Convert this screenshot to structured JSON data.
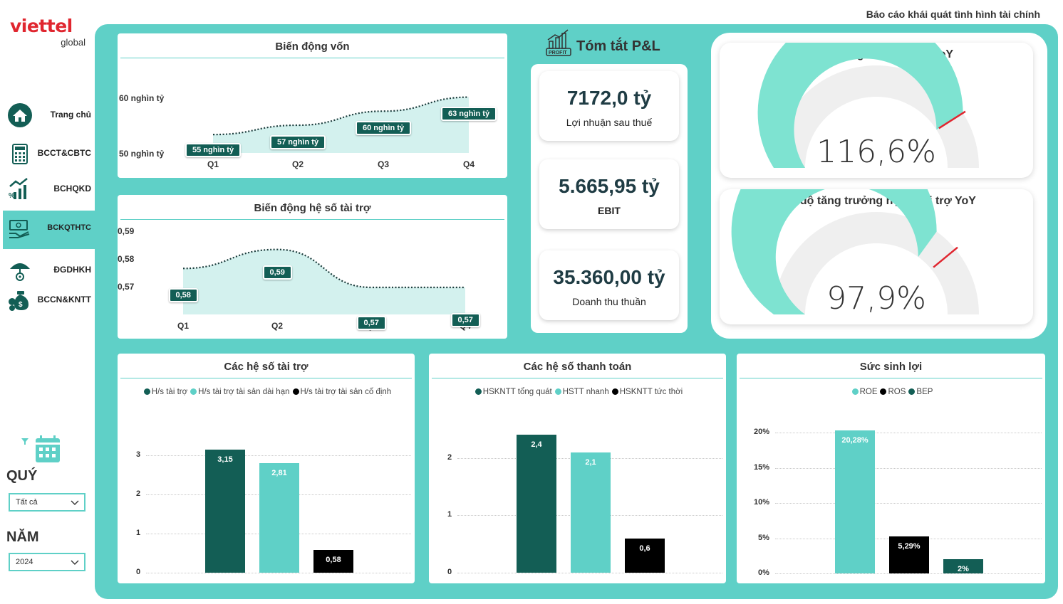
{
  "brand": {
    "name": "viettel",
    "sub": "global"
  },
  "report_title": "Báo cáo khái quát tình hình tài chính",
  "sidebar": {
    "items": [
      {
        "label": "Trang chủ",
        "icon": "home-icon"
      },
      {
        "label": "BCCT&CBTC",
        "icon": "calculator-icon"
      },
      {
        "label": "BCHQKD",
        "icon": "growth-chart-icon"
      },
      {
        "label": "BCKQTHTC",
        "icon": "cash-hand-icon",
        "active": true
      },
      {
        "label": "ĐGDHKH",
        "icon": "umbrella-icon"
      },
      {
        "label": "BCCN&KNTT",
        "icon": "money-bag-icon"
      }
    ]
  },
  "filters": {
    "quarter": {
      "label": "QUÝ",
      "value": "Tất cả"
    },
    "year": {
      "label": "NĂM",
      "value": "2024"
    }
  },
  "capital_chart": {
    "chart_data": {
      "type": "area",
      "title": "Biến động vốn",
      "categories": [
        "Q1",
        "Q2",
        "Q3",
        "Q4"
      ],
      "values": [
        55,
        57,
        60,
        63
      ],
      "data_labels": [
        "55 nghìn tỷ",
        "57 nghìn tỷ",
        "60 nghìn tỷ",
        "63 nghìn tỷ"
      ],
      "y_ticks": [
        "60 nghìn tỷ",
        "50 nghìn tỷ"
      ],
      "ylim": [
        50,
        60
      ],
      "color": "#5fd0c7"
    }
  },
  "funding_ratio_chart": {
    "chart_data": {
      "type": "area",
      "title": "Biến động hệ số tài trợ",
      "categories": [
        "Q1",
        "Q2",
        "Q3",
        "Q4"
      ],
      "values": [
        0.58,
        0.59,
        0.57,
        0.57
      ],
      "data_labels": [
        "0,58",
        "0,59",
        "0,57",
        "0,57"
      ],
      "y_ticks": [
        "0,59",
        "0,58",
        "0,57"
      ],
      "color": "#5fd0c7"
    }
  },
  "pl_summary": {
    "title": "Tóm tắt P&L",
    "icon": "profit-chart-icon",
    "kpis": [
      {
        "value": "7172,0 tỷ",
        "label": "Lợi nhuận sau thuế"
      },
      {
        "value": "5.665,95 tỷ",
        "label": "EBIT"
      },
      {
        "value": "35.360,00 tỷ",
        "label": "Doanh thu thuần"
      }
    ]
  },
  "gauges": [
    {
      "title": "Tốc độ tăng trưởng vốn YoY",
      "value_text": "116,6%",
      "fill_fraction": 0.82,
      "target_fraction": 0.82
    },
    {
      "title": "Tốc độ tăng trưởng hệ số tài trợ YoY",
      "value_text": "97,9%",
      "fill_fraction": 0.7,
      "target_fraction": 0.78
    }
  ],
  "bar_charts": [
    {
      "chart_data": {
        "type": "bar",
        "title": "Các hệ số tài trợ",
        "categories": [
          "H/s tài trợ",
          "H/s tài trợ tài sản dài hạn",
          "H/s tài trợ tài sản cố định"
        ],
        "values": [
          3.15,
          2.81,
          0.58
        ],
        "data_labels": [
          "3,15",
          "2,81",
          "0,58"
        ],
        "colors": [
          "#135e55",
          "#5fd0c7",
          "#000000"
        ],
        "y_ticks": [
          "3",
          "2",
          "1",
          "0"
        ],
        "ylim": [
          0,
          3.5
        ]
      }
    },
    {
      "chart_data": {
        "type": "bar",
        "title": "Các hệ số thanh toán",
        "categories": [
          "HSKNTT tổng quát",
          "HSTT nhanh",
          "HSKNTT tức thời"
        ],
        "values": [
          2.4,
          2.1,
          0.6
        ],
        "data_labels": [
          "2,4",
          "2,1",
          "0,6"
        ],
        "colors": [
          "#135e55",
          "#5fd0c7",
          "#000000"
        ],
        "y_ticks": [
          "2",
          "1",
          "0"
        ],
        "ylim": [
          0,
          2.8
        ]
      }
    },
    {
      "chart_data": {
        "type": "bar",
        "title": "Sức sinh lợi",
        "categories": [
          "ROE",
          "ROS",
          "BEP"
        ],
        "values": [
          20.28,
          5.29,
          2
        ],
        "data_labels": [
          "20,28%",
          "5,29%",
          "2%"
        ],
        "colors": [
          "#5fd0c7",
          "#000000",
          "#135e55"
        ],
        "y_ticks": [
          "20%",
          "15%",
          "10%",
          "5%",
          "0%"
        ],
        "ylim": [
          0,
          20
        ]
      }
    }
  ]
}
